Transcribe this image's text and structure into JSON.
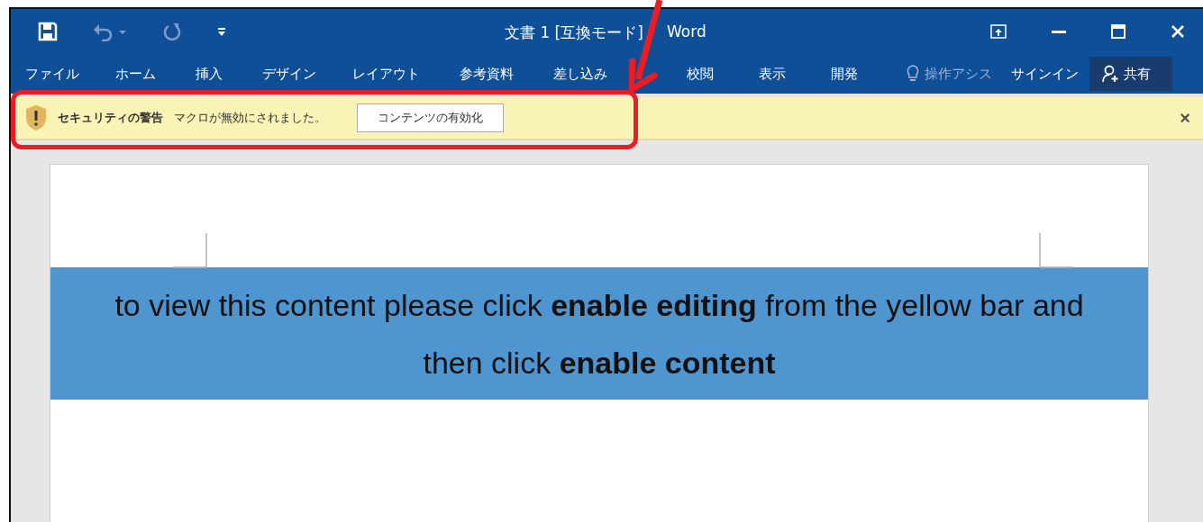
{
  "window": {
    "title": "文書 1 [互換モード]",
    "title_tail": "Word"
  },
  "tabs": [
    {
      "label": "ファイル",
      "selected": false
    },
    {
      "label": "ホーム",
      "selected": false
    },
    {
      "label": "挿入",
      "selected": false
    },
    {
      "label": "デザイン",
      "selected": false
    },
    {
      "label": "レイアウト",
      "selected": false
    },
    {
      "label": "参考資料",
      "selected": false
    },
    {
      "label": "差し込み",
      "selected": false
    },
    {
      "label": "校閲",
      "selected": false
    },
    {
      "label": "表示",
      "selected": false
    },
    {
      "label": "開発",
      "selected": false
    }
  ],
  "tell_me": {
    "placeholder": "操作アシス"
  },
  "sign_in": "サインイン",
  "share": "共有",
  "message_bar": {
    "title": "セキュリティの警告",
    "message": "マクロが無効にされました。",
    "button": "コンテンツの有効化",
    "close": "×"
  },
  "document": {
    "paragraph": "to view this content please click **enable editing** from the yellow bar and then click **enable content**"
  }
}
